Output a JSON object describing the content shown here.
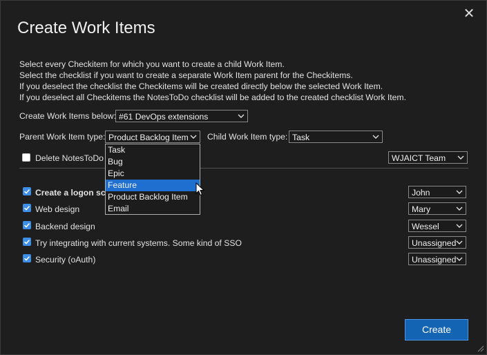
{
  "dialog": {
    "title": "Create Work Items",
    "close_glyph": "✕",
    "intro_lines": [
      "Select every Checkitem for which you want to create a child Work Item.",
      "Select the checklist if you want to create a separate Work Item parent for the Checkitems.",
      "If you deselect the checklist the Checkitems will be created directly below the selected Work Item.",
      "If you deselect all Checkitems the NotesToDo checklist will be added to the created checklist Work Item."
    ]
  },
  "form": {
    "create_below_label": "Create Work Items below:",
    "create_below_value": "#61 DevOps extensions",
    "parent_type_label": "Parent Work Item type:",
    "parent_type_value": "Product Backlog Item",
    "child_type_label": "Child Work Item type:",
    "child_type_value": "Task",
    "delete_label": "Delete NotesToDo c",
    "delete_checked": false,
    "team_value": "WJAICT Team"
  },
  "parent_type_dropdown": {
    "options": [
      "Task",
      "Bug",
      "Epic",
      "Feature",
      "Product Backlog Item",
      "Email"
    ],
    "highlighted": "Feature"
  },
  "checklist": [
    {
      "label": "Create a logon scr",
      "checked": true,
      "bold": true,
      "assignee": "John"
    },
    {
      "label": "Web design",
      "checked": true,
      "bold": false,
      "assignee": "Mary"
    },
    {
      "label": "Backend design",
      "checked": true,
      "bold": false,
      "assignee": "Wessel"
    },
    {
      "label": "Try integrating with current systems. Some kind of SSO",
      "checked": true,
      "bold": false,
      "assignee": "Unassigned"
    },
    {
      "label": "Security (oAuth)",
      "checked": true,
      "bold": false,
      "assignee": "Unassigned"
    }
  ],
  "actions": {
    "create_label": "Create"
  },
  "colors": {
    "accent": "#1464b4",
    "checkbox": "#3d8ee8",
    "highlight": "#1e6fcf"
  }
}
